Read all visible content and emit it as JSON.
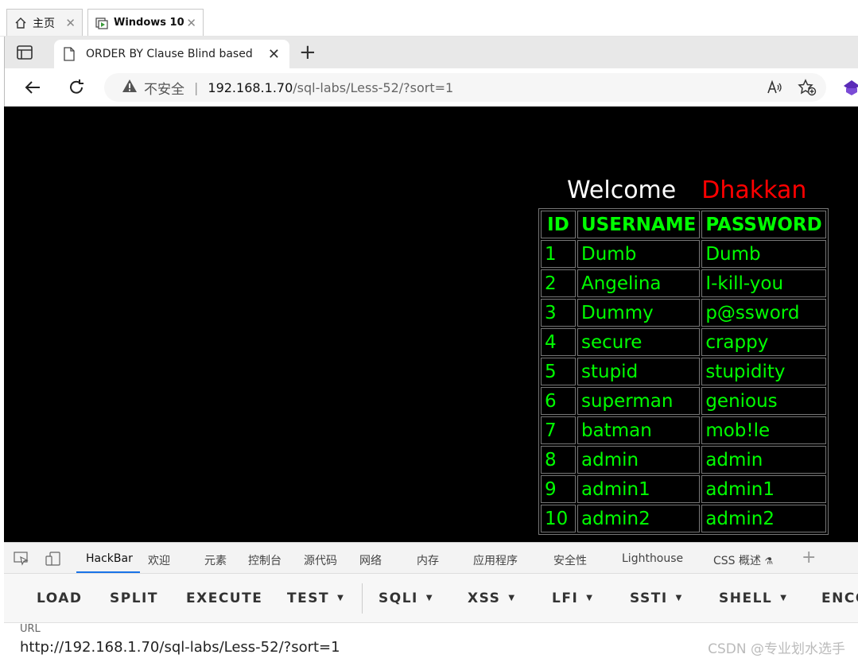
{
  "vm_tabs": [
    {
      "label": "主页",
      "icon": "home-icon"
    },
    {
      "label": "Windows 10",
      "icon": "vm-icon"
    }
  ],
  "browser": {
    "tab_title": "ORDER BY Clause Blind based",
    "security_label": "不安全",
    "url_host": "192.168.1.70",
    "url_path": "/sql-labs/Less-52/?sort=1"
  },
  "page": {
    "welcome": "Welcome",
    "name": "Dhakkan",
    "headers": [
      "ID",
      "USERNAME",
      "PASSWORD"
    ],
    "rows": [
      [
        "1",
        "Dumb",
        "Dumb"
      ],
      [
        "2",
        "Angelina",
        "I-kill-you"
      ],
      [
        "3",
        "Dummy",
        "p@ssword"
      ],
      [
        "4",
        "secure",
        "crappy"
      ],
      [
        "5",
        "stupid",
        "stupidity"
      ],
      [
        "6",
        "superman",
        "genious"
      ],
      [
        "7",
        "batman",
        "mob!le"
      ],
      [
        "8",
        "admin",
        "admin"
      ],
      [
        "9",
        "admin1",
        "admin1"
      ],
      [
        "10",
        "admin2",
        "admin2"
      ]
    ]
  },
  "devtools": {
    "tabs": [
      "HackBar",
      "欢迎",
      "元素",
      "控制台",
      "源代码",
      "网络",
      "内存",
      "应用程序",
      "安全性",
      "Lighthouse",
      "CSS 概述"
    ],
    "active_tab": "HackBar"
  },
  "hackbar": {
    "buttons": [
      "LOAD",
      "SPLIT",
      "EXECUTE",
      "TEST",
      "SQLI",
      "XSS",
      "LFI",
      "SSTI",
      "SHELL",
      "ENCO"
    ],
    "url_label": "URL",
    "url_value": "http://192.168.1.70/sql-labs/Less-52/?sort=1"
  },
  "watermark": "CSDN @专业划水选手"
}
